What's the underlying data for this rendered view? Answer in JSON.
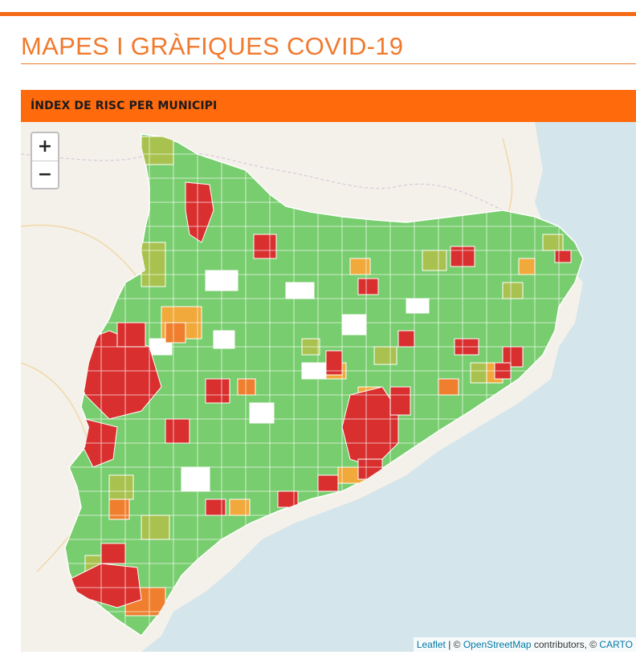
{
  "page": {
    "title": "MAPES I GRÀFIQUES COVID-19"
  },
  "panel": {
    "header": "ÍNDEX DE RISC PER MUNICIPI"
  },
  "map": {
    "zoom_in_label": "+",
    "zoom_out_label": "−",
    "attribution": {
      "leaflet": "Leaflet",
      "sep1": " | © ",
      "osm": "OpenStreetMap",
      "mid": " contributors, © ",
      "carto": "CARTO"
    },
    "legend_colors": {
      "low": "#78cd6e",
      "medium_low": "#a9c24f",
      "medium": "#f0a93a",
      "medium_high": "#ef7f2e",
      "high": "#d92f2f",
      "no_data": "#ffffff"
    },
    "sea_color": "#d5e5ec",
    "land_color": "#f4f1ea"
  },
  "colors": {
    "accent": "#f46b14",
    "header": "#ff6a0d"
  }
}
